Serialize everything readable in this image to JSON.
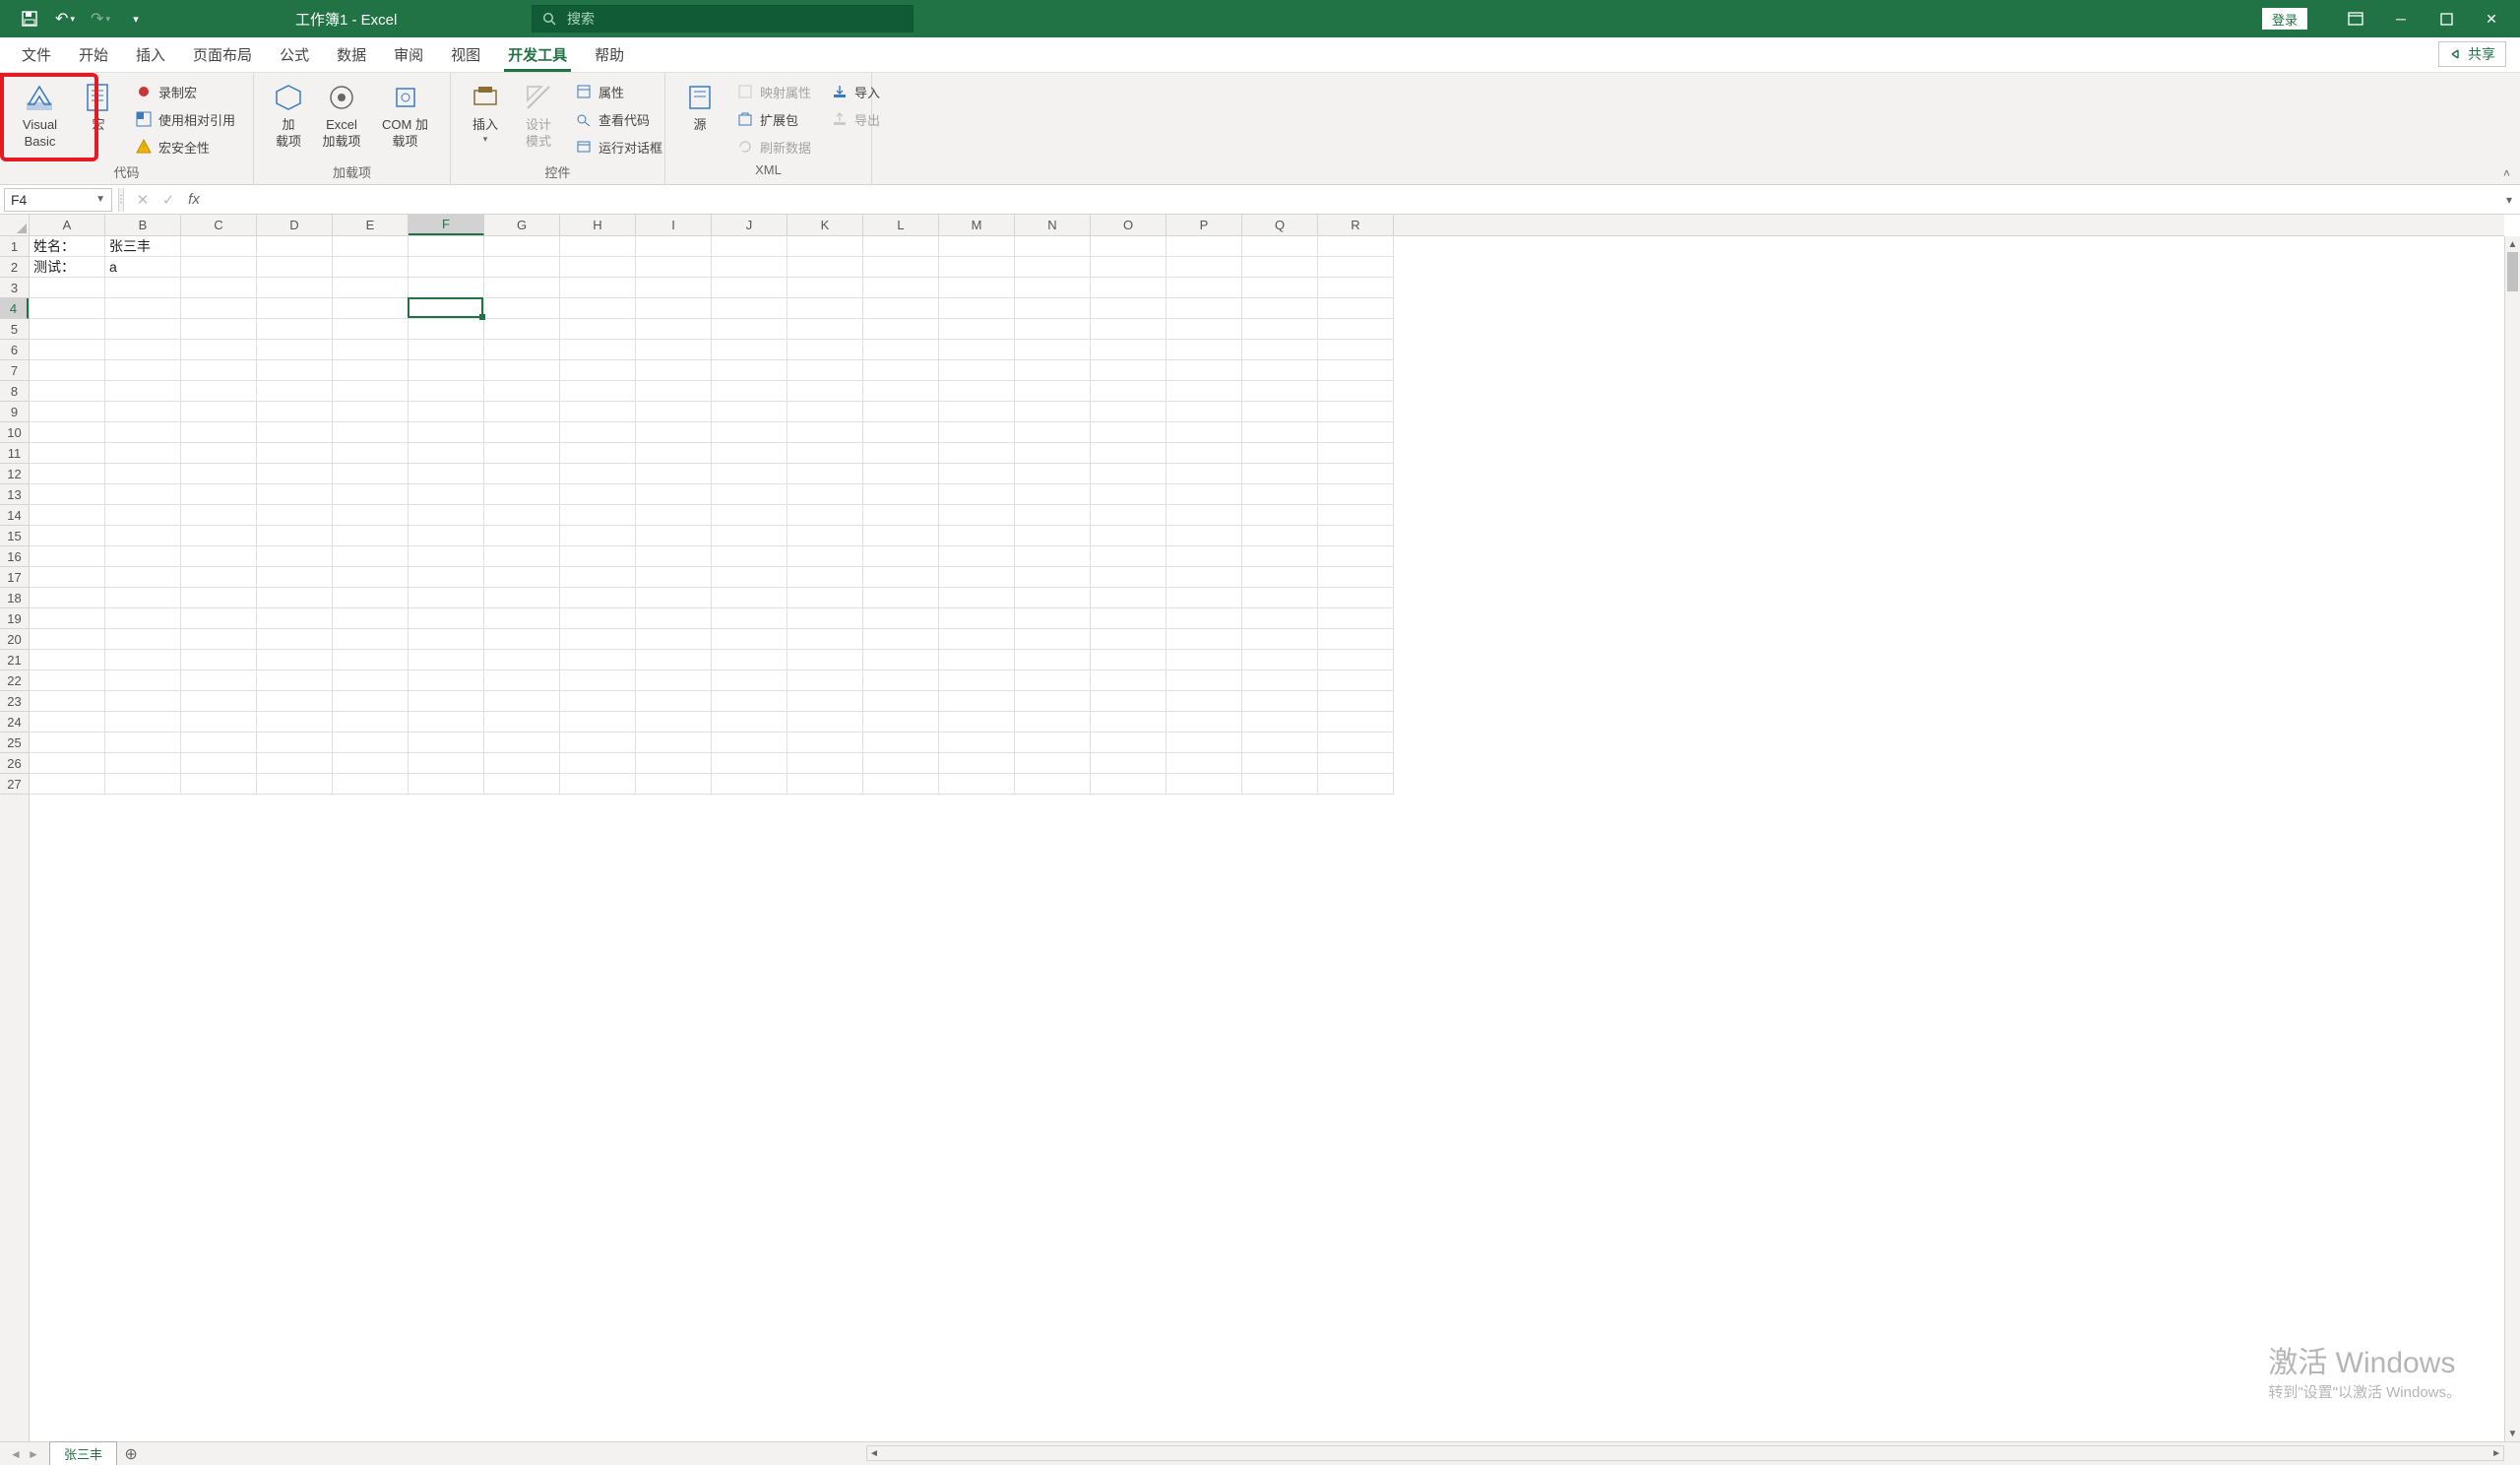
{
  "title": "工作簿1  -  Excel",
  "search_placeholder": "搜索",
  "login": "登录",
  "tabs": {
    "file": "文件",
    "home": "开始",
    "insert": "插入",
    "layout": "页面布局",
    "formula": "公式",
    "data": "数据",
    "review": "审阅",
    "view": "视图",
    "dev": "开发工具",
    "help": "帮助"
  },
  "share": "共享",
  "ribbon": {
    "code": {
      "vb": "Visual Basic",
      "macro": "宏",
      "record": "录制宏",
      "relative": "使用相对引用",
      "security": "宏安全性",
      "label": "代码"
    },
    "addins": {
      "addin": "加\n载项",
      "excel_addin": "Excel\n加载项",
      "com_addin": "COM 加载项",
      "label": "加载项"
    },
    "controls": {
      "insert": "插入",
      "design": "设计模式",
      "props": "属性",
      "view_code": "查看代码",
      "run_dialog": "运行对话框",
      "label": "控件"
    },
    "xml": {
      "source": "源",
      "map_prop": "映射属性",
      "expand": "扩展包",
      "refresh": "刷新数据",
      "import": "导入",
      "export": "导出",
      "label": "XML"
    }
  },
  "namebox": "F4",
  "columns": [
    "A",
    "B",
    "C",
    "D",
    "E",
    "F",
    "G",
    "H",
    "I",
    "J",
    "K",
    "L",
    "M",
    "N",
    "O",
    "P",
    "Q",
    "R"
  ],
  "row_count": 27,
  "selected": {
    "col_index": 5,
    "row_index": 3
  },
  "cells": {
    "A1": "姓名：",
    "B1": "张三丰",
    "A2": "测试：",
    "B2": "a"
  },
  "sheet_tab": "张三丰",
  "watermark": {
    "l1": "激活 Windows",
    "l2": "转到\"设置\"以激活 Windows。"
  }
}
